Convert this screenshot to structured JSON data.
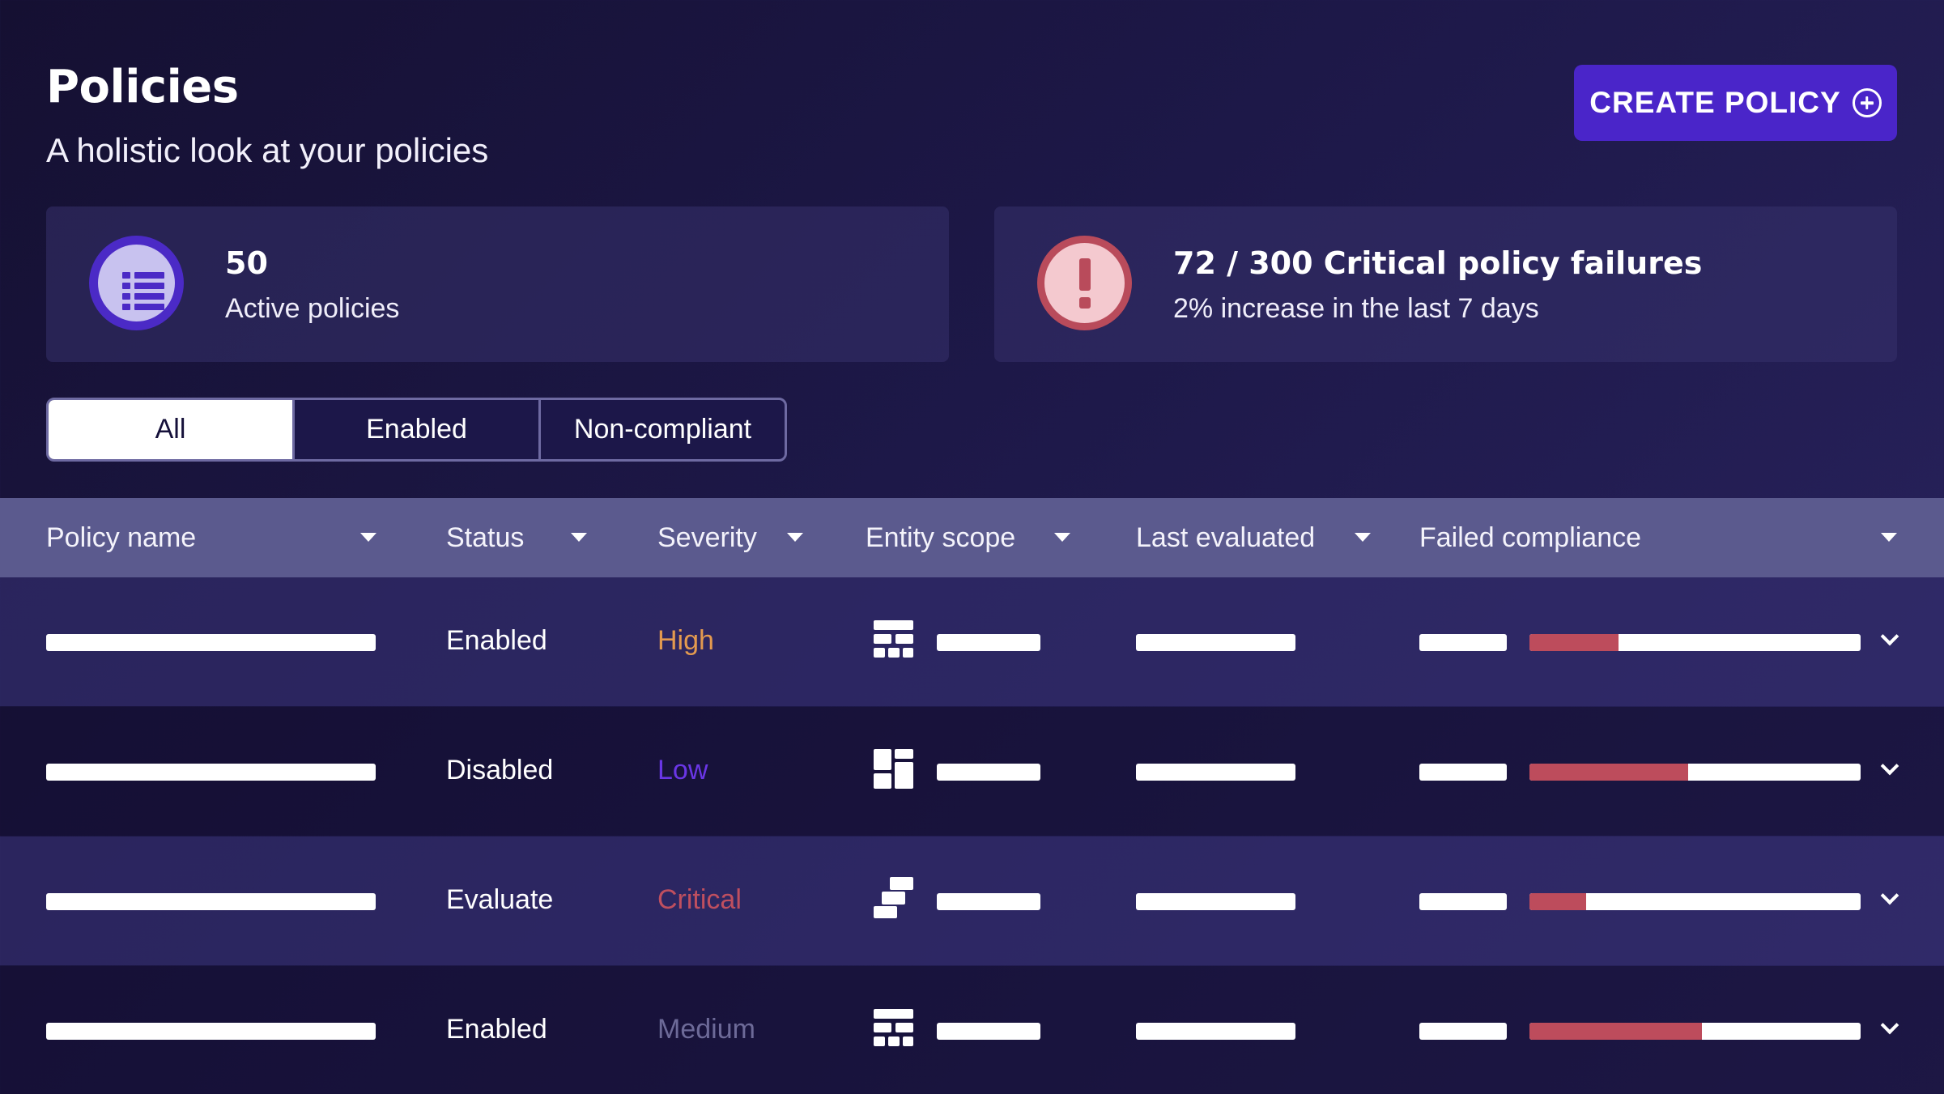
{
  "header": {
    "title": "Policies",
    "subtitle": "A holistic look at your policies",
    "create_button_label": "CREATE POLICY",
    "create_button_icon": "plus-circle-icon"
  },
  "stats": [
    {
      "value": "50",
      "label": "Active policies",
      "icon": "list-icon",
      "color": "#4b2ac6"
    },
    {
      "value": "72 / 300 Critical policy failures",
      "label": "2% increase in the last 7 days",
      "icon": "exclamation-icon",
      "color": "#b94b5b"
    }
  ],
  "filters": {
    "options": [
      "All",
      "Enabled",
      "Non-compliant"
    ],
    "selected": "All"
  },
  "table": {
    "columns": [
      "Policy name",
      "Status",
      "Severity",
      "Entity scope",
      "Last evaluated",
      "Failed compliance"
    ],
    "rows": [
      {
        "status": "Enabled",
        "severity": "High",
        "severity_color": "#e39a4f",
        "scope_icon": "grid-icon",
        "failed_fraction": 0.27
      },
      {
        "status": "Disabled",
        "severity": "Low",
        "severity_color": "#6a36e6",
        "scope_icon": "dashboard-icon",
        "failed_fraction": 0.48
      },
      {
        "status": "Evaluate",
        "severity": "Critical",
        "severity_color": "#bf4f5f",
        "scope_icon": "stack-icon",
        "failed_fraction": 0.17
      },
      {
        "status": "Enabled",
        "severity": "Medium",
        "severity_color": "#6d6a98",
        "scope_icon": "grid-icon",
        "failed_fraction": 0.52
      }
    ]
  },
  "colors": {
    "accent": "#4a25c9",
    "failure_bar": "#bd4c5c",
    "header_row": "#5b5a8e"
  }
}
